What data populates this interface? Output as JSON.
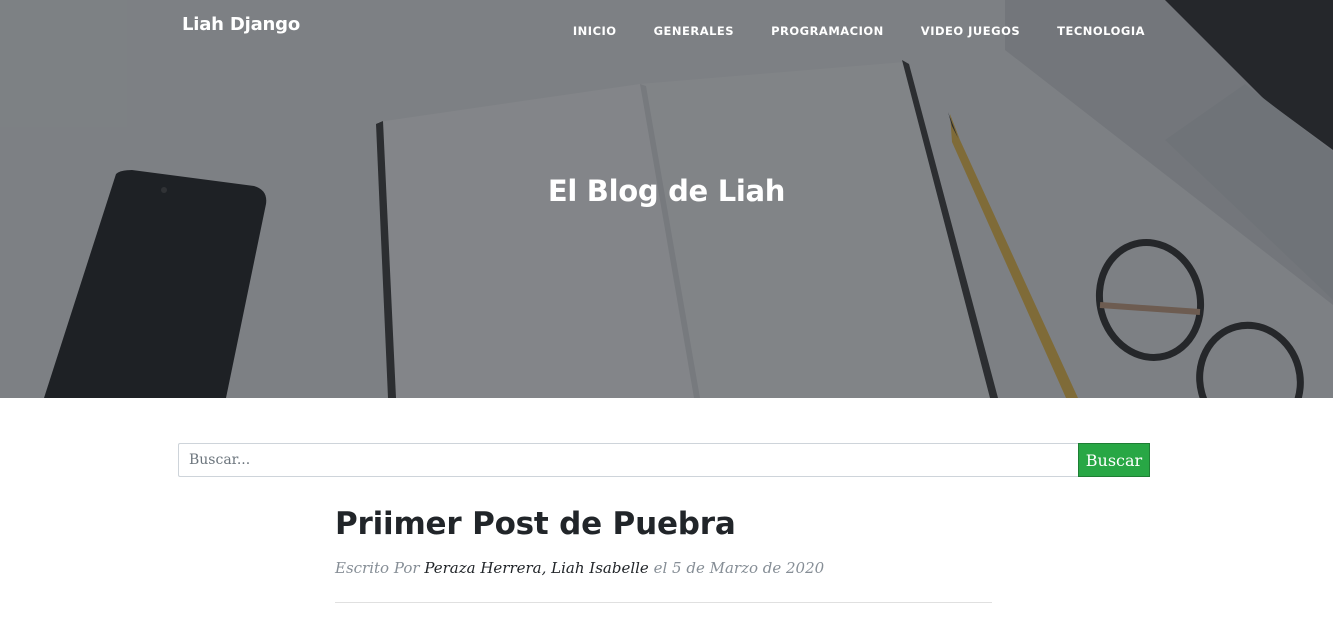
{
  "nav": {
    "brand": "Liah Django",
    "items": [
      {
        "label": "INICIO"
      },
      {
        "label": "GENERALES"
      },
      {
        "label": "PROGRAMACION"
      },
      {
        "label": "VIDEO JUEGOS"
      },
      {
        "label": "TECNOLOGIA"
      }
    ]
  },
  "hero": {
    "heading": "El Blog de Liah"
  },
  "search": {
    "placeholder": "Buscar...",
    "button_label": "Buscar"
  },
  "posts": [
    {
      "title": "Priimer Post de Puebra",
      "meta_prefix": "Escrito Por",
      "author": "Peraza Herrera, Liah Isabelle",
      "date_text": "el 5 de Marzo de 2020"
    }
  ],
  "colors": {
    "search_button": "#28a745",
    "hero_overlay": "#212529"
  }
}
